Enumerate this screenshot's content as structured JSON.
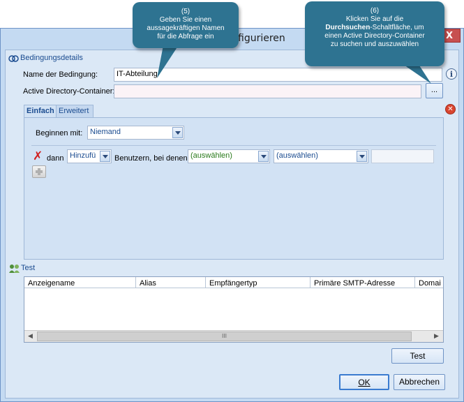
{
  "window": {
    "title": "figurieren",
    "close_label": "X"
  },
  "details": {
    "section_label": "Bedingungsdetails",
    "name_label": "Name der Bedingung:",
    "name_value": "IT-Abteilung",
    "container_label": "Active Directory-Container:",
    "container_value": "",
    "browse_label": "..."
  },
  "tabs": [
    {
      "label": "Einfach",
      "active": true
    },
    {
      "label": "Erweitert",
      "active": false
    }
  ],
  "simple": {
    "start_label": "Beginnen mit:",
    "start_value": "Niemand",
    "then_label": "dann",
    "action_value": "Hinzufü",
    "users_label": "Benutzern, bei denen",
    "attribute_value": "(auswählen)",
    "operator_value": "(auswählen)",
    "value_field": ""
  },
  "test": {
    "section_label": "Test",
    "columns": [
      "Anzeigename",
      "Alias",
      "Empfängertyp",
      "Primäre SMTP-Adresse",
      "Domai"
    ],
    "rows": [],
    "scroll_thumb": "III",
    "test_button": "Test"
  },
  "footer": {
    "ok_label": "OK",
    "cancel_label": "Abbrechen"
  },
  "callouts": {
    "c5": {
      "number": "(5)",
      "line1": "Geben Sie einen",
      "line2": "aussagekräftigen Namen",
      "line3": "für die Abfrage ein"
    },
    "c6": {
      "number": "(6)",
      "line1": "Klicken Sie auf die",
      "bold": "Durchsuchen",
      "line2_rest": "-Schaltfläche, um",
      "line3": "einen Active Directory-Container",
      "line4": "zu suchen und auszuwählen"
    }
  },
  "colors": {
    "window_bg": "#c4daf2",
    "callout_bg": "#2e7391",
    "accent_blue": "#1b4c90",
    "attribute_green": "#2a7a1c",
    "close_red": "#c75050"
  }
}
